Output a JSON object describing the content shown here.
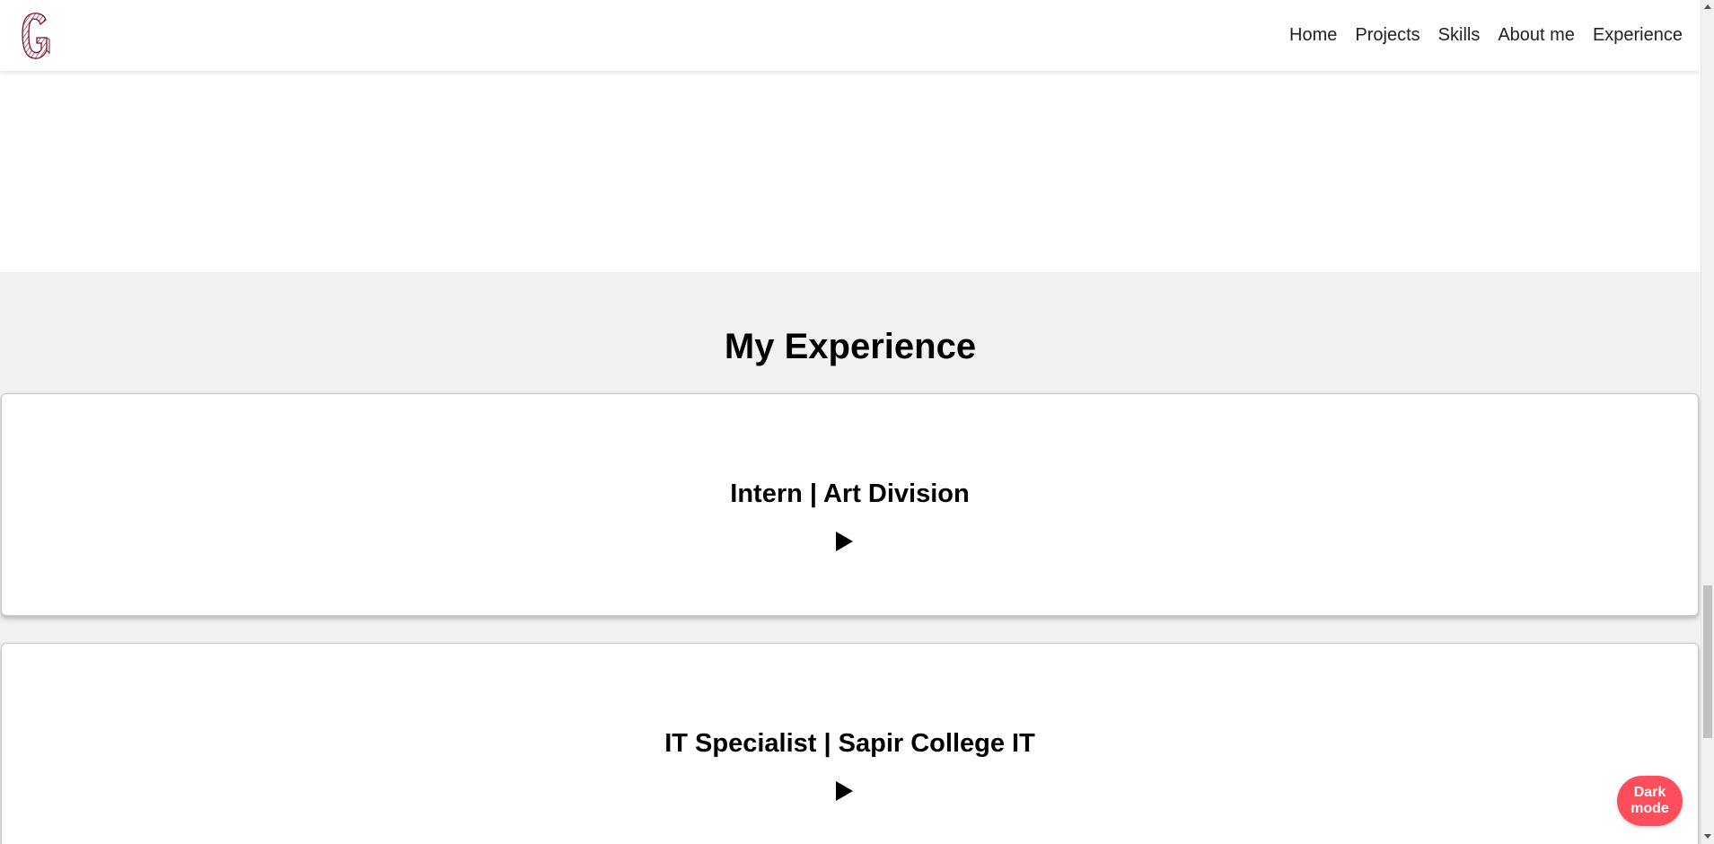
{
  "nav": {
    "logo_letter": "G",
    "items": [
      {
        "label": "Home"
      },
      {
        "label": "Projects"
      },
      {
        "label": "Skills"
      },
      {
        "label": "About me"
      },
      {
        "label": "Experience"
      }
    ]
  },
  "experience": {
    "title": "My Experience",
    "cards": [
      {
        "title": "Intern | Art Division"
      },
      {
        "title": "IT Specialist | Sapir College IT"
      }
    ]
  },
  "dark_mode_button": {
    "label": "Dark\nmode"
  },
  "colors": {
    "accent": "#ff4e5b",
    "logo": "#9b1b30",
    "section_bg": "#f1f1f1"
  },
  "icons": {
    "logo": "letter-g-logo-icon",
    "expand": "play-triangle-icon"
  }
}
